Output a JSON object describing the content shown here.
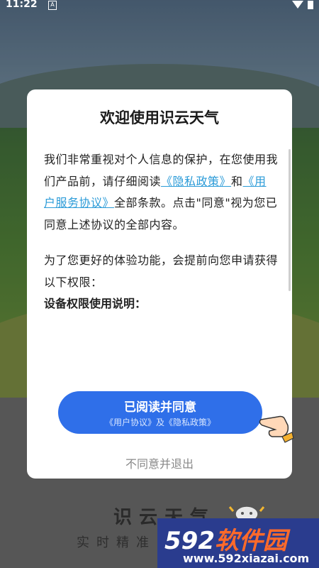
{
  "status_bar": {
    "time": "11:22",
    "icons": [
      "a-notification-icon",
      "wifi-icon",
      "battery-icon"
    ]
  },
  "dialog": {
    "title": "欢迎使用识云天气",
    "para1_prefix": "我们非常重视对个人信息的保护，在您使用我们产品前，请仔细阅读",
    "privacy_link": "《隐私政策》",
    "and": "和",
    "user_link": "《用户服务协议》",
    "para1_suffix": "全部条款。点击\"同意\"视为您已同意上述协议的全部内容。",
    "para2": "为了您更好的体验功能，会提前向您申请获得以下权限：",
    "permissions_heading": "设备权限使用说明：",
    "agree_label": "已阅读并同意",
    "agree_sub": "《用户协议》及《隐私政策》",
    "decline_label": "不同意并退出"
  },
  "background": {
    "app_name": "识云天气",
    "app_slogan": "实时精准"
  },
  "watermark": {
    "brand_num": "592",
    "brand_cn": "软件园",
    "url": "www.592xiazai.com"
  },
  "colors": {
    "accent": "#2f6fe9",
    "link": "#2b9bd8",
    "watermark_bg": "#2a3c8e",
    "watermark_orange": "#ff6a2a"
  }
}
